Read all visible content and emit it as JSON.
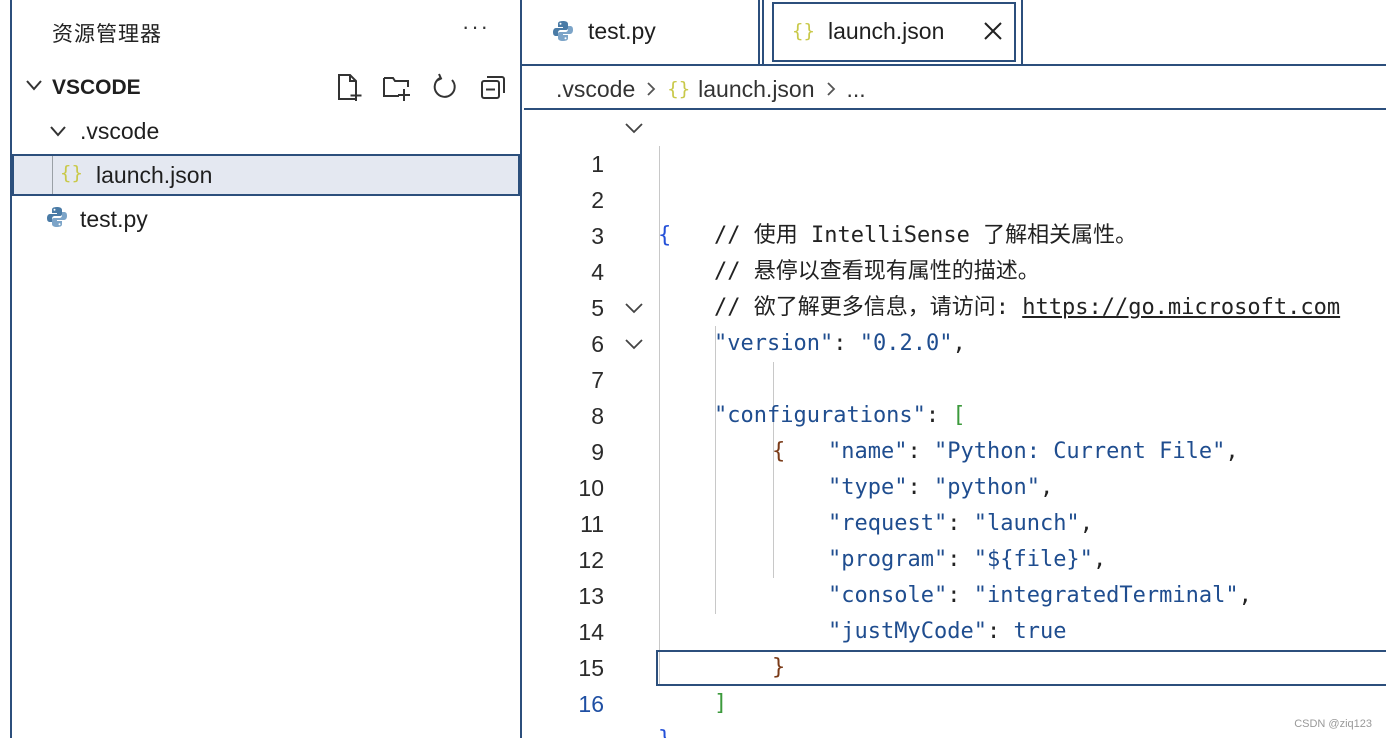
{
  "sidebar": {
    "title": "资源管理器",
    "more_label": "···",
    "section": {
      "label": "VSCODE"
    },
    "actions": [
      "new-file-icon",
      "new-folder-icon",
      "refresh-icon",
      "collapse-all-icon"
    ],
    "tree": {
      "folder": ".vscode",
      "file1": "launch.json",
      "file2": "test.py"
    }
  },
  "tabs": {
    "tab1": "test.py",
    "tab2": "launch.json",
    "active": "launch.json"
  },
  "breadcrumb": {
    "part1": ".vscode",
    "part2": "launch.json",
    "part3": "..."
  },
  "json_icon": "{}",
  "editor": {
    "lines": [
      {
        "n": "1"
      },
      {
        "n": "2",
        "text": "// 使用 IntelliSense 了解相关属性。"
      },
      {
        "n": "3",
        "text": "// 悬停以查看现有属性的描述。"
      },
      {
        "n": "4",
        "text": "// 欲了解更多信息，请访问: ",
        "link": "https://go.microsoft.com"
      },
      {
        "n": "5",
        "key": "\"version\"",
        "value": "\"0.2.0\""
      },
      {
        "n": "6",
        "key": "\"configurations\""
      },
      {
        "n": "7"
      },
      {
        "n": "8",
        "key": "\"name\"",
        "value": "\"Python: Current File\""
      },
      {
        "n": "9",
        "key": "\"type\"",
        "value": "\"python\""
      },
      {
        "n": "10",
        "key": "\"request\"",
        "value": "\"launch\""
      },
      {
        "n": "11",
        "key": "\"program\"",
        "value": "\"${file}\""
      },
      {
        "n": "12",
        "key": "\"console\"",
        "value": "\"integratedTerminal\""
      },
      {
        "n": "13",
        "key": "\"justMyCode\"",
        "value": "true"
      },
      {
        "n": "14"
      },
      {
        "n": "15"
      },
      {
        "n": "16"
      }
    ],
    "active_line": "16"
  },
  "colors": {
    "accent": "#2c4f7c",
    "json_icon": "#c9c94a",
    "python_icon": "#4a7ba6",
    "string": "#1f4d8f",
    "brace": "#2450d8",
    "bracket": "#3c9a3c",
    "inner_brace": "#7a3a17"
  },
  "watermark": "CSDN @ziq123"
}
